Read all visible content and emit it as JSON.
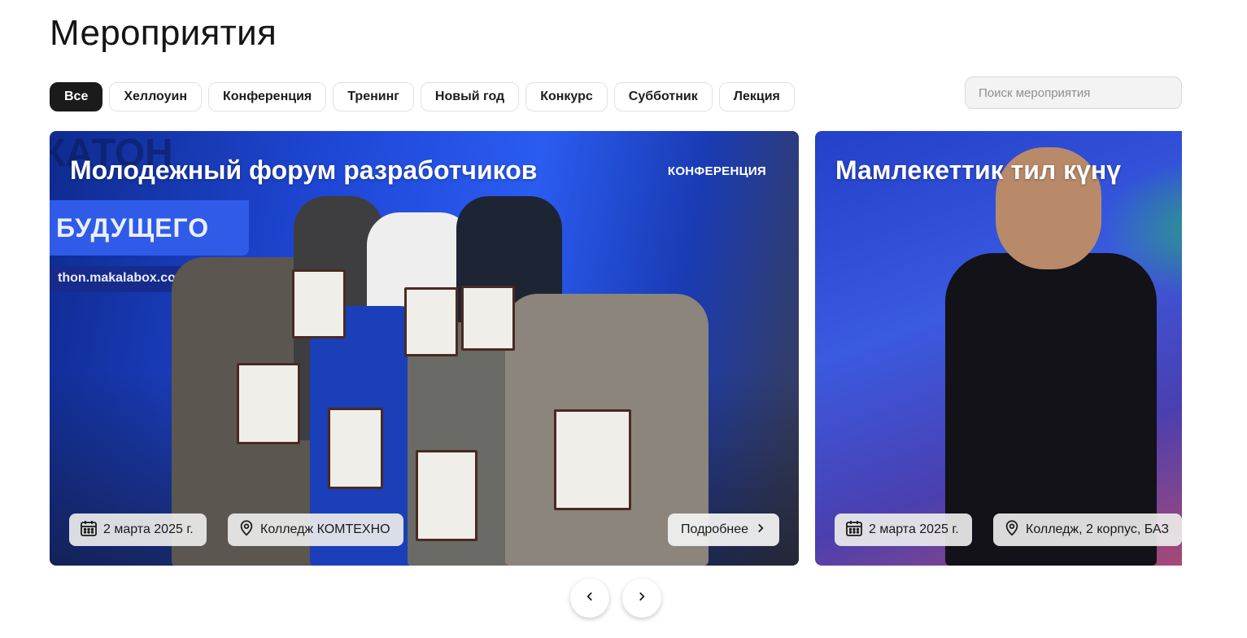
{
  "page": {
    "title": "Мероприятия"
  },
  "filters": [
    {
      "label": "Все",
      "active": true
    },
    {
      "label": "Хеллоуин",
      "active": false
    },
    {
      "label": "Конференция",
      "active": false
    },
    {
      "label": "Тренинг",
      "active": false
    },
    {
      "label": "Новый год",
      "active": false
    },
    {
      "label": "Конкурс",
      "active": false
    },
    {
      "label": "Субботник",
      "active": false
    },
    {
      "label": "Лекция",
      "active": false
    }
  ],
  "search": {
    "placeholder": "Поиск мероприятия",
    "value": ""
  },
  "events": [
    {
      "title": "Молодежный форум разработчиков",
      "category": "КОНФЕРЕНЦИЯ",
      "date": "2 марта 2025 г.",
      "location": "Колледж КОМТЕХНО",
      "more_label": "Подробнее",
      "photo_screen_text": [
        "КАТОН",
        "БУДУЩЕГО",
        "thon.makalabox.com"
      ]
    },
    {
      "title": "Мамлекеттик тил күнү",
      "category": "",
      "date": "2 марта 2025 г.",
      "location": "Колледж, 2 корпус, БАЗ"
    }
  ],
  "carousel": {
    "prev_icon": "chevron-left-icon",
    "next_icon": "chevron-right-icon"
  },
  "colors": {
    "active_chip": "#1b1b1b",
    "pill_bg": "#ebebeb",
    "search_bg": "#f3f3f3"
  }
}
